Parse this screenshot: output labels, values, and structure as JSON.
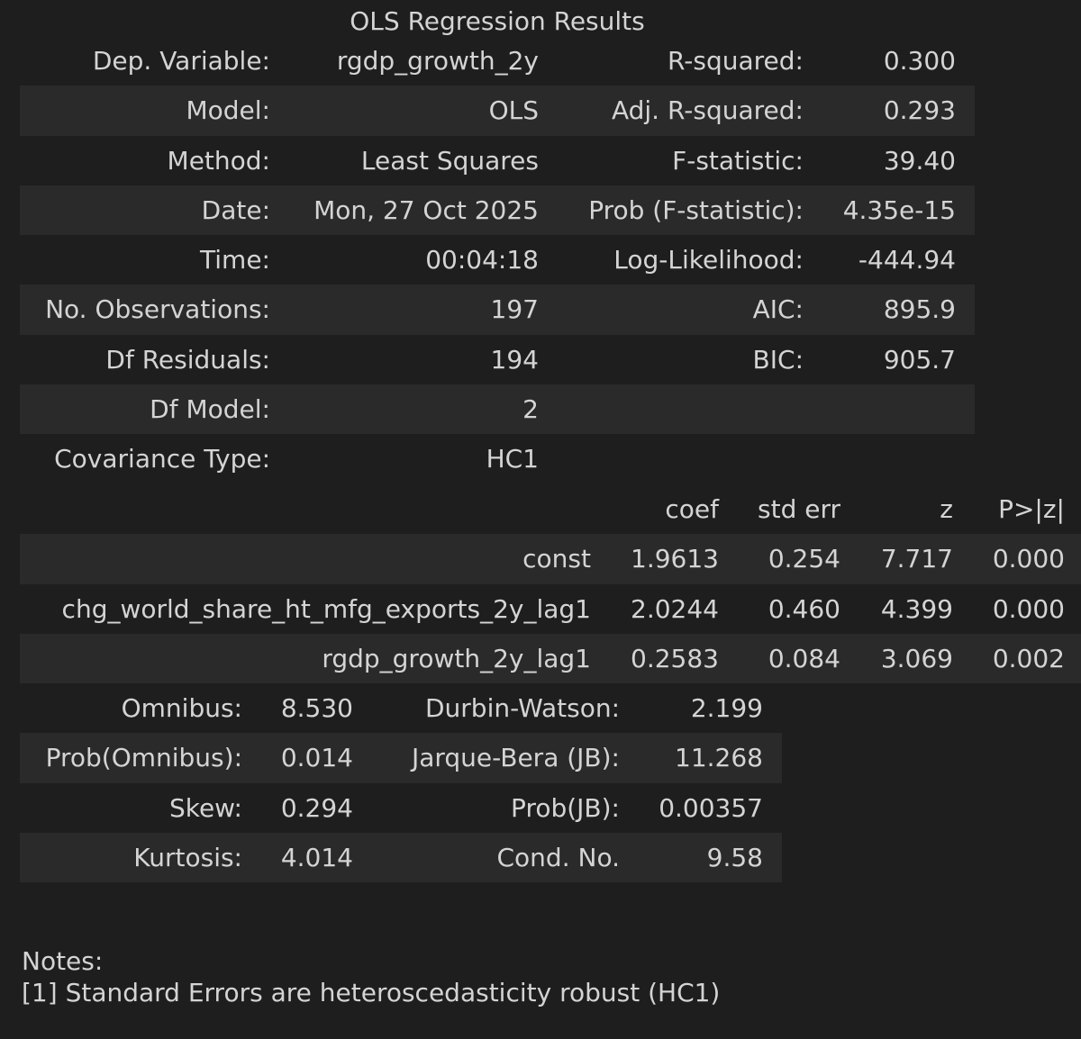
{
  "caption": "OLS Regression Results",
  "summary": {
    "rows": [
      {
        "l1": "Dep. Variable:",
        "v1": "rgdp_growth_2y",
        "l2": "R-squared:",
        "v2": "0.300"
      },
      {
        "l1": "Model:",
        "v1": "OLS",
        "l2": "Adj. R-squared:",
        "v2": "0.293"
      },
      {
        "l1": "Method:",
        "v1": "Least Squares",
        "l2": "F-statistic:",
        "v2": "39.40"
      },
      {
        "l1": "Date:",
        "v1": "Mon, 27 Oct 2025",
        "l2": "Prob (F-statistic):",
        "v2": "4.35e-15"
      },
      {
        "l1": "Time:",
        "v1": "00:04:18",
        "l2": "Log-Likelihood:",
        "v2": "-444.94"
      },
      {
        "l1": "No. Observations:",
        "v1": "197",
        "l2": "AIC:",
        "v2": "895.9"
      },
      {
        "l1": "Df Residuals:",
        "v1": "194",
        "l2": "BIC:",
        "v2": "905.7"
      },
      {
        "l1": "Df Model:",
        "v1": "2",
        "l2": "",
        "v2": ""
      },
      {
        "l1": "Covariance Type:",
        "v1": "HC1",
        "l2": "",
        "v2": ""
      }
    ]
  },
  "coefficients": {
    "headers": [
      "",
      "coef",
      "std err",
      "z",
      "P>|z|"
    ],
    "rows": [
      {
        "name": "const",
        "coef": "1.9613",
        "std_err": "0.254",
        "z": "7.717",
        "p": "0.000"
      },
      {
        "name": "chg_world_share_ht_mfg_exports_2y_lag1",
        "coef": "2.0244",
        "std_err": "0.460",
        "z": "4.399",
        "p": "0.000"
      },
      {
        "name": "rgdp_growth_2y_lag1",
        "coef": "0.2583",
        "std_err": "0.084",
        "z": "3.069",
        "p": "0.002"
      }
    ]
  },
  "diagnostics": {
    "rows": [
      {
        "l1": "Omnibus:",
        "v1": "8.530",
        "l2": "Durbin-Watson:",
        "v2": "2.199"
      },
      {
        "l1": "Prob(Omnibus):",
        "v1": "0.014",
        "l2": "Jarque-Bera (JB):",
        "v2": "11.268"
      },
      {
        "l1": "Skew:",
        "v1": "0.294",
        "l2": "Prob(JB):",
        "v2": "0.00357"
      },
      {
        "l1": "Kurtosis:",
        "v1": "4.014",
        "l2": "Cond. No.",
        "v2": "9.58"
      }
    ]
  },
  "notes": {
    "title": "Notes:",
    "items": [
      "[1] Standard Errors are heteroscedasticity robust (HC1)"
    ]
  }
}
